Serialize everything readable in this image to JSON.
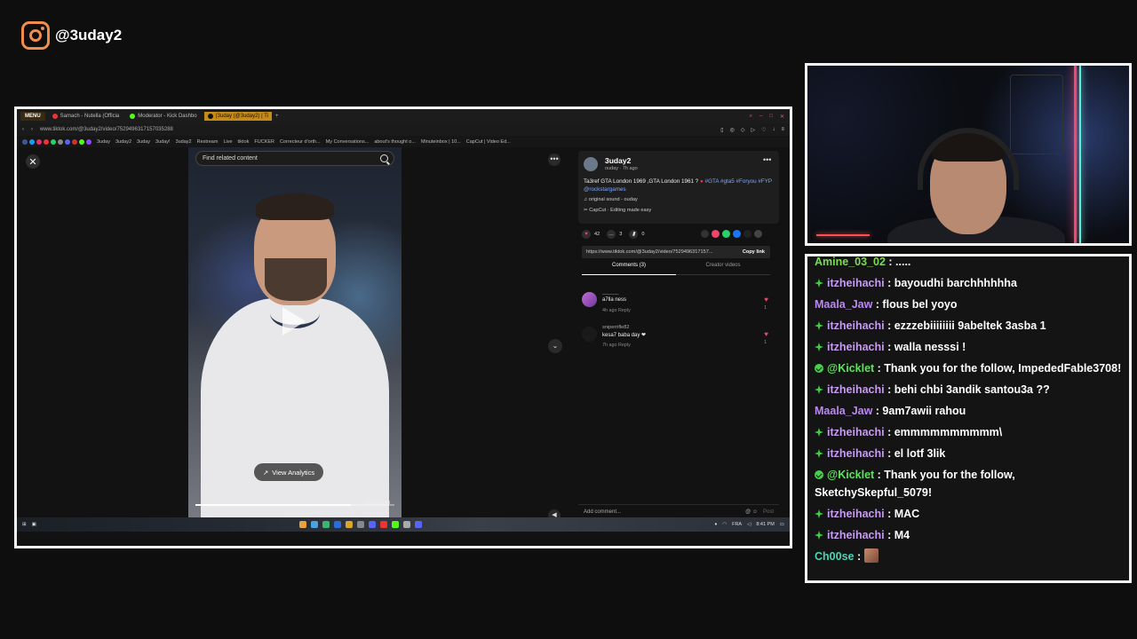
{
  "brand": {
    "handle": "@3uday2",
    "icon": "instagram-icon",
    "color": "#f08c4c"
  },
  "browser": {
    "menu_label": "MENU",
    "tabs": [
      {
        "label": "Samach - Nutella (Officia",
        "icon": "youtube-icon"
      },
      {
        "label": "Moderator - Kick Dashbo",
        "icon": "kick-icon"
      },
      {
        "label": "(3uday (@3uday2) | Ti",
        "icon": "tiktok-icon",
        "active": true
      }
    ],
    "url": "www.tiktok.com/@3uday2/video/7529496317157035288",
    "bookmarks": [
      "3uday",
      "3uday2",
      "3uday",
      "3uday!",
      "3uday2",
      "Restream",
      "Live",
      "tiktok",
      "FUCKER",
      "Correcteur d'orth...",
      "My Conversations...",
      "about's thought o...",
      "Minuteinbox | 10...",
      "CapCut | Video Ed..."
    ]
  },
  "video": {
    "search_placeholder": "Find related content",
    "analytics_label": "View Analytics",
    "time": "01:24/01:48",
    "progress": 0.78
  },
  "post": {
    "username": "3uday2",
    "subtitle": "ouday · 7h ago",
    "caption_text": "Ta3ref GTA London 1969 ,GTA London 1961 ? ",
    "caption_tags": "#GTA #gta5 #Foryou #FYP @rockstargames",
    "sound": "original sound - ouday",
    "capcut": "CapCut · Editing made easy",
    "likes": "42",
    "comments": "3",
    "saves": "0",
    "link": "https://www.tiktok.com/@3uday2/video/7529496317157...",
    "copy_label": "Copy link",
    "tab_comments": "Comments (3)",
    "tab_creator": "Creator videos",
    "add_comment_placeholder": "Add comment...",
    "post_label": "Post"
  },
  "comments": [
    {
      "user": "______",
      "text": "a7lla ness",
      "meta": "4h ago    Reply",
      "likes": "1"
    },
    {
      "user": "sniperrifle82",
      "text": "kesa7 baba day ❤",
      "meta": "7h ago    Reply",
      "likes": "1"
    }
  ],
  "taskbar": {
    "lang": "FRA",
    "time": "8:41 PM"
  },
  "chat": [
    {
      "badge": "",
      "user": "Amine_03_02",
      "text": ": .....",
      "color": "u-lime"
    },
    {
      "badge": "diamond",
      "user": "itzheihachi",
      "text": ": bayoudhi barchhhhhha",
      "color": "u-purple"
    },
    {
      "badge": "",
      "user": "Maala_Jaw",
      "text": ": flous bel yoyo",
      "color": "u-violet"
    },
    {
      "badge": "diamond",
      "user": "itzheihachi",
      "text": ": ezzzebiiiiiiii 9abeltek 3asba 1",
      "color": "u-purple"
    },
    {
      "badge": "diamond",
      "user": "itzheihachi",
      "text": ": walla nesssi !",
      "color": "u-purple"
    },
    {
      "badge": "check",
      "user": "@Kicklet",
      "text": ": Thank you for the follow, ImpededFable3708!",
      "color": "u-green"
    },
    {
      "badge": "diamond",
      "user": "itzheihachi",
      "text": ": behi chbi 3andik santou3a ??",
      "color": "u-purple"
    },
    {
      "badge": "",
      "user": "Maala_Jaw",
      "text": ": 9am7awii rahou",
      "color": "u-violet"
    },
    {
      "badge": "diamond",
      "user": "itzheihachi",
      "text": ": emmmmmmmmmm\\",
      "color": "u-purple"
    },
    {
      "badge": "diamond",
      "user": "itzheihachi",
      "text": ": el lotf 3lik",
      "color": "u-purple"
    },
    {
      "badge": "check",
      "user": "@Kicklet",
      "text": ": Thank you for the follow, SketchySkepful_5079!",
      "color": "u-green"
    },
    {
      "badge": "diamond",
      "user": "itzheihachi",
      "text": ": MAC",
      "color": "u-purple"
    },
    {
      "badge": "diamond",
      "user": "itzheihachi",
      "text": ": M4",
      "color": "u-purple"
    },
    {
      "badge": "",
      "user": "Ch00se",
      "text": ": ",
      "color": "u-teal",
      "emote": true
    }
  ]
}
